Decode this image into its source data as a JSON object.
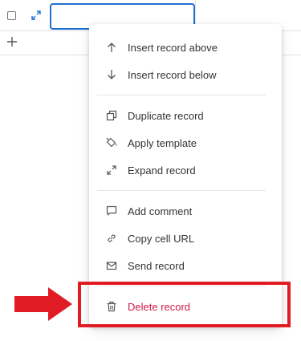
{
  "grid": {
    "row_checkbox": "row-select",
    "expand_icon": "expand-arrows-icon",
    "add_icon": "plus-icon"
  },
  "context_menu": {
    "groups": [
      [
        {
          "label": "Insert record above",
          "icon": "arrow-up-icon"
        },
        {
          "label": "Insert record below",
          "icon": "arrow-down-icon"
        }
      ],
      [
        {
          "label": "Duplicate record",
          "icon": "duplicate-icon"
        },
        {
          "label": "Apply template",
          "icon": "paint-bucket-icon"
        },
        {
          "label": "Expand record",
          "icon": "expand-icon"
        }
      ],
      [
        {
          "label": "Add comment",
          "icon": "comment-icon"
        },
        {
          "label": "Copy cell URL",
          "icon": "link-icon"
        },
        {
          "label": "Send record",
          "icon": "envelope-icon"
        }
      ],
      [
        {
          "label": "Delete record",
          "icon": "trash-icon"
        }
      ]
    ]
  },
  "colors": {
    "accent": "#1f6fd1",
    "danger": "#d21a47",
    "annotation": "#e01b24"
  }
}
